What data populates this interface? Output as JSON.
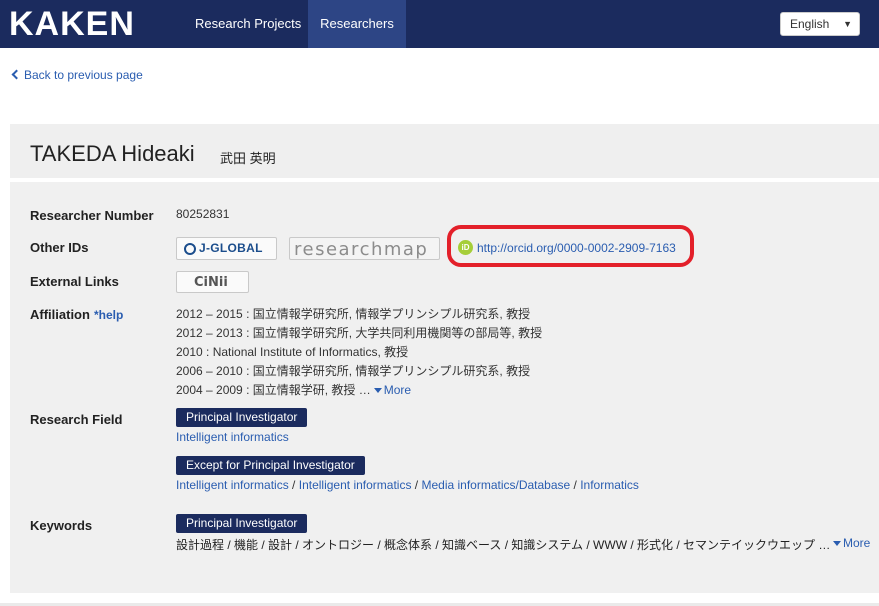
{
  "header": {
    "logo": "KAKEN",
    "tabs": [
      {
        "label": "Research Projects"
      },
      {
        "label": "Researchers"
      }
    ],
    "language": "English"
  },
  "back_link": "Back to previous page",
  "researcher": {
    "name_en": "TAKEDA Hideaki",
    "name_jp": "武田 英明"
  },
  "labels": {
    "researcher_number": "Researcher Number",
    "other_ids": "Other IDs",
    "external_links": "External Links",
    "affiliation": "Affiliation",
    "help": "*help",
    "research_field": "Research Field",
    "keywords": "Keywords"
  },
  "researcher_number": "80252831",
  "other_ids": {
    "jglobal": "J-GLOBAL",
    "researchmap": "researchmap",
    "orcid_icon": "iD",
    "orcid_url": "http://orcid.org/0000-0002-2909-7163"
  },
  "external_links": {
    "cinii": "CiNii"
  },
  "affiliation": [
    "2012 – 2015 : 国立情報学研究所, 情報学プリンシプル研究系, 教授",
    "2012 – 2013 : 国立情報学研究所, 大学共同利用機関等の部局等, 教授",
    "2010 : National Institute of Informatics, 教授",
    "2006 – 2010 : 国立情報学研究所, 情報学プリンシプル研究系, 教授",
    "2004 – 2009 : 国立情報学研, 教授 …"
  ],
  "more_label": "More",
  "research_field": {
    "pi_badge": "Principal Investigator",
    "pi_fields": [
      "Intelligent informatics"
    ],
    "except_badge": "Except for Principal Investigator",
    "except_fields": [
      "Intelligent informatics",
      "Intelligent informatics",
      "Media informatics/Database",
      "Informatics"
    ]
  },
  "keywords": {
    "pi_badge": "Principal Investigator",
    "text": "設計過程 / 機能 / 設計 / オントロジー / 概念体系 / 知識ベース / 知識システム / WWW / 形式化 / セマンテイックウエップ …"
  }
}
